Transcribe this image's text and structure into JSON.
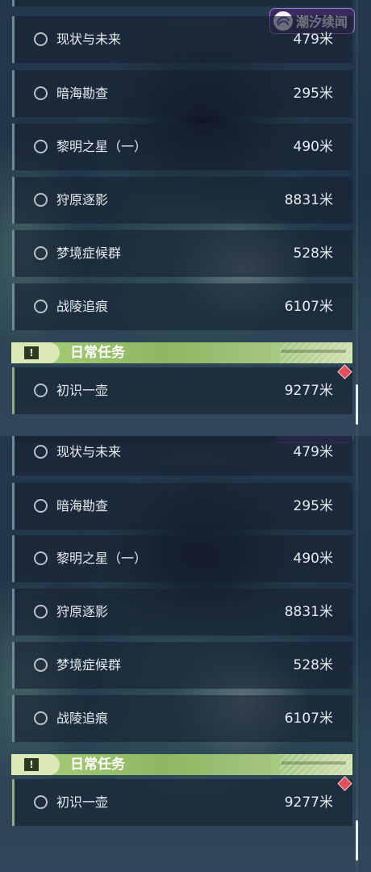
{
  "badge": {
    "label": "潮汐续闻"
  },
  "section": {
    "title": "日常任务"
  },
  "quests": [
    {
      "name": "现状与未来",
      "distance": "479米"
    },
    {
      "name": "暗海勘查",
      "distance": "295米"
    },
    {
      "name": "黎明之星（一）",
      "distance": "490米"
    },
    {
      "name": "狩原逐影",
      "distance": "8831米"
    },
    {
      "name": "梦境症候群",
      "distance": "528米"
    },
    {
      "name": "战陵追痕",
      "distance": "6107米"
    }
  ],
  "daily_quests": [
    {
      "name": "初识一壶",
      "distance": "9277米"
    }
  ],
  "colors": {
    "section_green": "#a9cf78",
    "badge_purple": "#3a2a5e",
    "alert_red": "#e0505c"
  },
  "icons": {
    "badge": "tide-logo-icon",
    "section": "exclamation-icon",
    "quest": "radio-circle-icon",
    "alert": "diamond-alert-icon"
  }
}
